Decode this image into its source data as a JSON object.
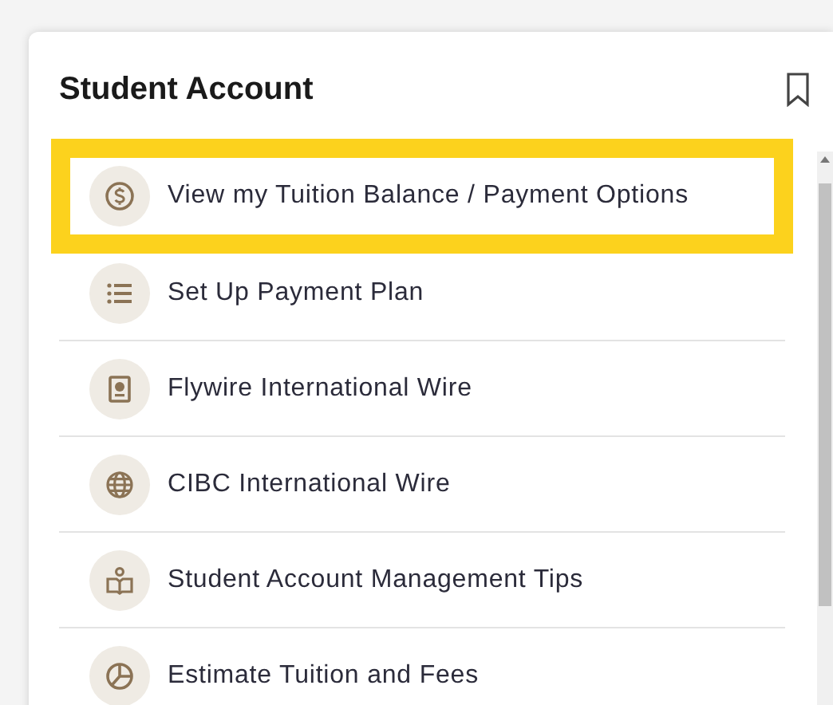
{
  "card": {
    "title": "Student Account"
  },
  "items": [
    {
      "label": "View my Tuition Balance / Payment Options",
      "highlighted": true
    },
    {
      "label": "Set Up Payment Plan",
      "highlighted": false
    },
    {
      "label": "Flywire International Wire",
      "highlighted": false
    },
    {
      "label": "CIBC International Wire",
      "highlighted": false
    },
    {
      "label": "Student Account Management Tips",
      "highlighted": false
    },
    {
      "label": "Estimate Tuition and Fees",
      "highlighted": false
    }
  ]
}
